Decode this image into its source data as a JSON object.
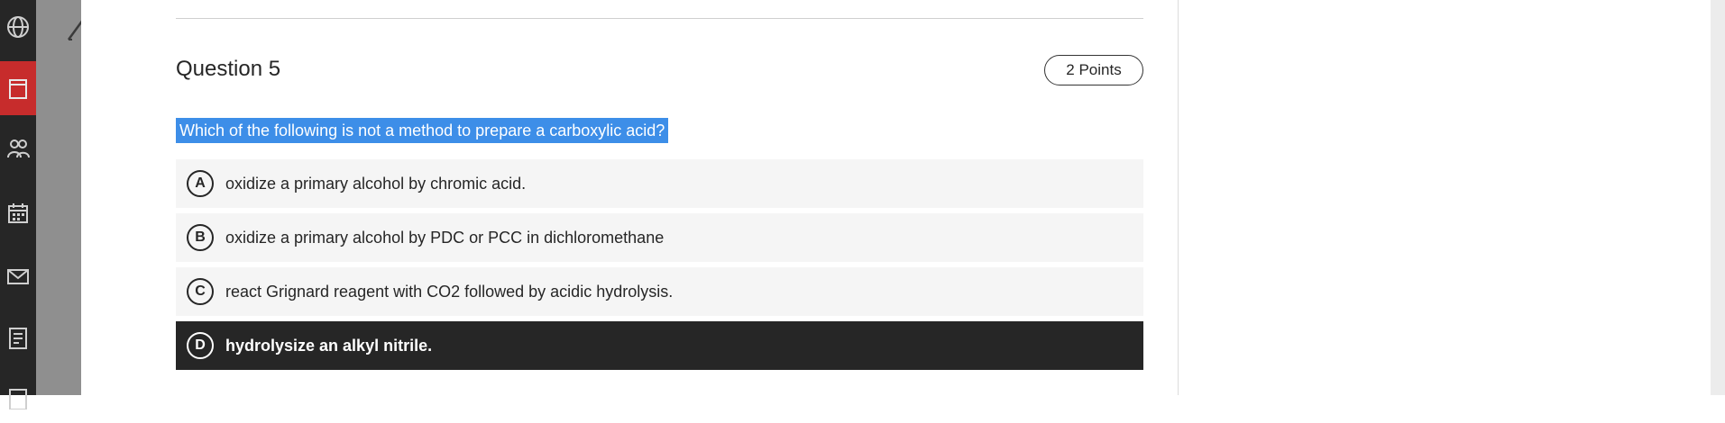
{
  "sidebar": {
    "icons": [
      "globe-icon",
      "courses-icon",
      "groups-icon",
      "calendar-icon",
      "messages-icon",
      "grades-icon"
    ]
  },
  "question": {
    "title": "Question 5",
    "points": "2 Points",
    "text": "Which of the following is not a method to prepare a carboxylic acid?",
    "options": [
      {
        "letter": "A",
        "text": "oxidize a primary alcohol by chromic acid.",
        "selected": false
      },
      {
        "letter": "B",
        "text": "oxidize a primary alcohol by PDC or PCC in dichloromethane",
        "selected": false
      },
      {
        "letter": "C",
        "text": "react Grignard reagent with CO2 followed by acidic hydrolysis.",
        "selected": false
      },
      {
        "letter": "D",
        "text": "hydrolysize an alkyl nitrile.",
        "selected": true
      }
    ]
  },
  "colors": {
    "selection_highlight": "#3d8ee8",
    "selected_option_bg": "#262626",
    "rail_bg": "#262626",
    "rail_active": "#c72c2c"
  }
}
